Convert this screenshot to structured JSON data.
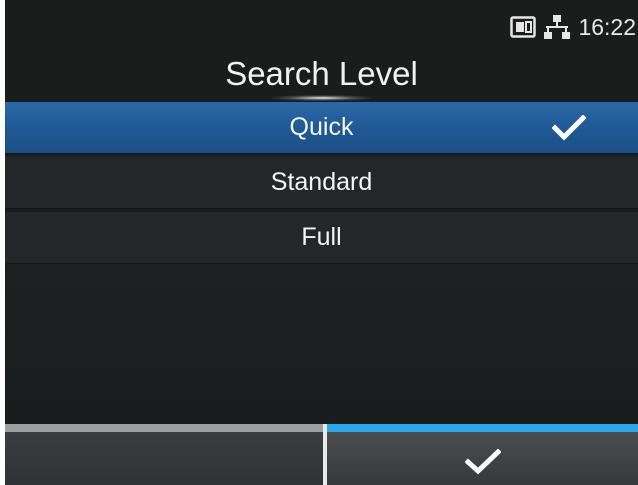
{
  "status": {
    "time": "16:22",
    "icons": [
      "storage-icon",
      "network-icon"
    ]
  },
  "header": {
    "title": "Search Level"
  },
  "options": [
    {
      "label": "Quick",
      "selected": true
    },
    {
      "label": "Standard",
      "selected": false
    },
    {
      "label": "Full",
      "selected": false
    }
  ],
  "softkeys": {
    "left": {
      "label": ""
    },
    "right": {
      "icon": "check-icon"
    }
  },
  "colors": {
    "selected_row": "#1f5893",
    "row": "#24272a",
    "background": "#1b1d1d",
    "left_key_accent": "#9d9fa1",
    "right_key_accent": "#2aa7ea"
  }
}
